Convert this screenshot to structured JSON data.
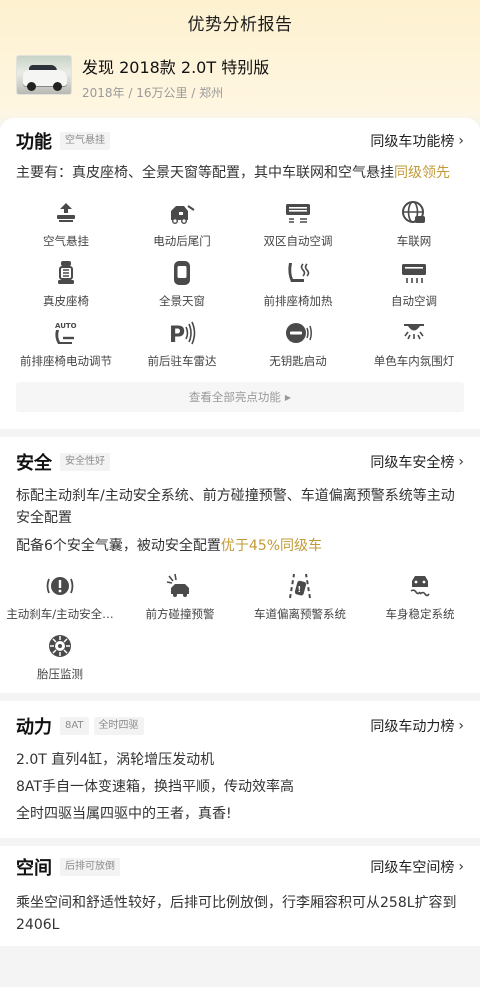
{
  "page": {
    "title": "优势分析报告"
  },
  "car": {
    "name": "发现 2018款 2.0T 特别版",
    "meta": "2018年 / 16万公里 / 郑州"
  },
  "function": {
    "title": "功能",
    "tag": "空气悬挂",
    "rank_link": "同级车功能榜",
    "desc_prefix": "主要有：真皮座椅、全景天窗等配置，其中车联网和空气悬挂",
    "desc_highlight": "同级领先",
    "features": [
      {
        "label": "空气悬挂",
        "icon": "air-suspension-icon"
      },
      {
        "label": "电动后尾门",
        "icon": "power-tailgate-icon"
      },
      {
        "label": "双区自动空调",
        "icon": "dual-zone-ac-icon"
      },
      {
        "label": "车联网",
        "icon": "connected-car-icon"
      },
      {
        "label": "真皮座椅",
        "icon": "leather-seat-icon"
      },
      {
        "label": "全景天窗",
        "icon": "panoramic-sunroof-icon"
      },
      {
        "label": "前排座椅加热",
        "icon": "seat-heating-icon"
      },
      {
        "label": "自动空调",
        "icon": "auto-ac-icon"
      },
      {
        "label": "前排座椅电动调节",
        "icon": "power-seat-icon"
      },
      {
        "label": "前后驻车雷达",
        "icon": "parking-radar-icon"
      },
      {
        "label": "无钥匙启动",
        "icon": "keyless-start-icon"
      },
      {
        "label": "单色车内氛围灯",
        "icon": "ambient-light-icon"
      }
    ],
    "more_label": "查看全部亮点功能"
  },
  "safety": {
    "title": "安全",
    "tag": "安全性好",
    "rank_link": "同级车安全榜",
    "desc1": "标配主动刹车/主动安全系统、前方碰撞预警、车道偏离预警系统等主动安全配置",
    "desc2_prefix": "配备6个安全气囊，被动安全配置",
    "desc2_highlight": "优于45%同级车",
    "features": [
      {
        "label": "主动刹车/主动安全…",
        "icon": "active-brake-icon"
      },
      {
        "label": "前方碰撞预警",
        "icon": "collision-warning-icon"
      },
      {
        "label": "车道偏离预警系统",
        "icon": "lane-departure-icon"
      },
      {
        "label": "车身稳定系统",
        "icon": "stability-control-icon"
      },
      {
        "label": "胎压监测",
        "icon": "tire-pressure-icon"
      }
    ]
  },
  "power": {
    "title": "动力",
    "tags": [
      "8AT",
      "全时四驱"
    ],
    "rank_link": "同级车动力榜",
    "lines": [
      "2.0T 直列4缸，涡轮增压发动机",
      "8AT手自一体变速箱，换挡平顺，传动效率高",
      "全时四驱当属四驱中的王者，真香!"
    ]
  },
  "space": {
    "title": "空间",
    "tag": "后排可放倒",
    "rank_link": "同级车空间榜",
    "desc": "乘坐空间和舒适性较好，后排可比例放倒，行李厢容积可从258L扩容到2406L"
  },
  "colors": {
    "accent": "#c29b38",
    "icon": "#4a4a4a"
  }
}
